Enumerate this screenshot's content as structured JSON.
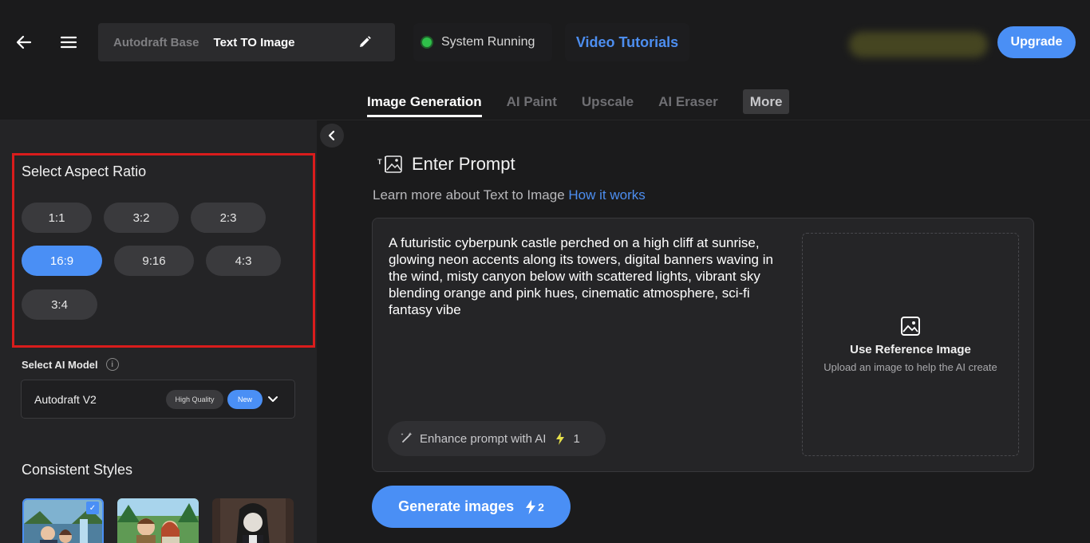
{
  "header": {
    "breadcrumb_base": "Autodraft Base",
    "breadcrumb_current": "Text TO Image",
    "status_text": "System Running",
    "tutorials_label": "Video Tutorials",
    "upgrade_label": "Upgrade"
  },
  "tabs": [
    {
      "label": "Image Generation",
      "active": true
    },
    {
      "label": "AI Paint"
    },
    {
      "label": "Upscale"
    },
    {
      "label": "AI Eraser"
    },
    {
      "label": "More"
    }
  ],
  "sidebar": {
    "aspect_title": "Select Aspect Ratio",
    "ratios": [
      "1:1",
      "3:2",
      "2:3",
      "16:9",
      "9:16",
      "4:3",
      "3:4"
    ],
    "selected_ratio": "16:9",
    "model_label": "Select AI Model",
    "model_name": "Autodraft V2",
    "model_badge_quality": "High Quality",
    "model_badge_new": "New",
    "styles_title": "Consistent Styles"
  },
  "main": {
    "prompt_title": "Enter Prompt",
    "learn_text": "Learn more about Text to Image",
    "learn_link": "How it works",
    "prompt_value": "A futuristic cyberpunk castle perched on a high cliff at sunrise, glowing neon accents along its towers, digital banners waving in the wind, misty canyon below with scattered lights, vibrant sky blending orange and pink hues, cinematic atmosphere, sci-fi fantasy vibe",
    "enhance_label": "Enhance prompt with AI",
    "enhance_cost": "1",
    "reference_title": "Use Reference Image",
    "reference_subtitle": "Upload an image to help the AI create",
    "generate_label": "Generate images",
    "generate_cost": "2"
  },
  "colors": {
    "accent": "#4a8ff5",
    "status_green": "#2fbf4a",
    "highlight_red": "#d91c1c",
    "bolt_yellow": "#e6e04a"
  },
  "icons": [
    "back-arrow-icon",
    "hamburger-menu-icon",
    "pencil-edit-icon",
    "chevron-left-icon",
    "text-image-icon",
    "image-icon",
    "magic-wand-icon",
    "lightning-bolt-icon",
    "info-icon",
    "chevron-down-icon",
    "check-icon"
  ]
}
